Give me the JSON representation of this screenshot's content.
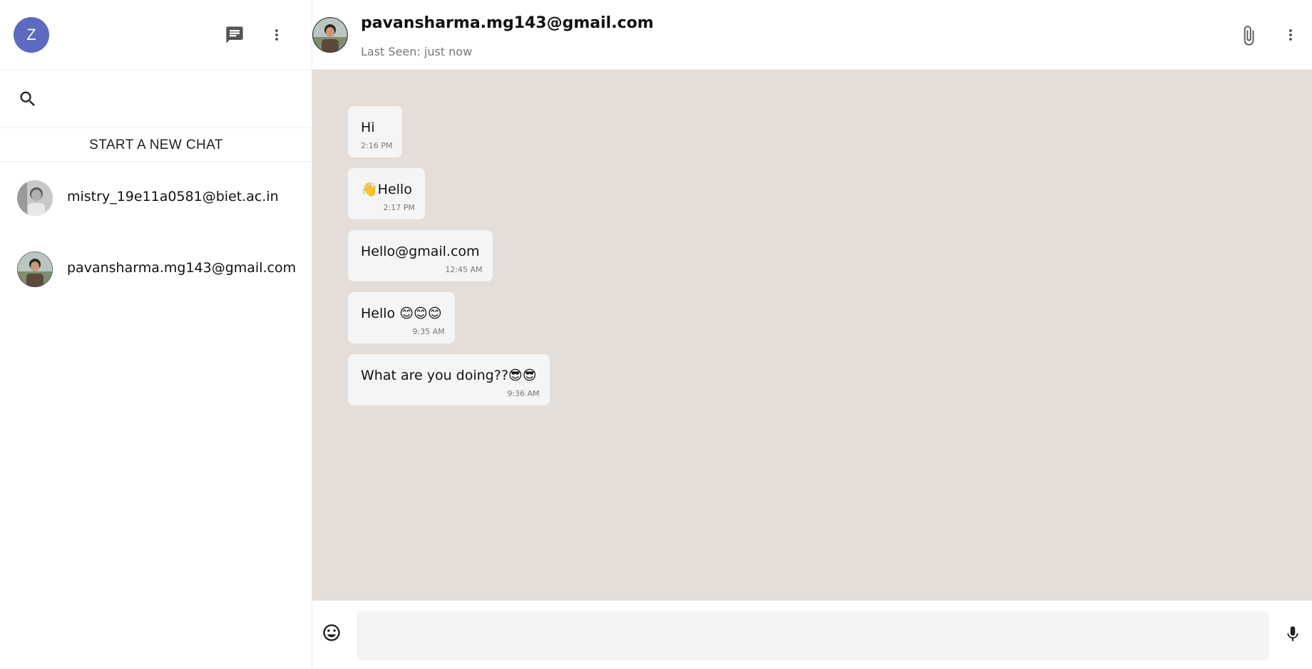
{
  "user": {
    "initial": "Z"
  },
  "sidebar": {
    "search_placeholder": "",
    "new_chat_label": "START A NEW CHAT",
    "chats": [
      {
        "name": "mistry_19e11a0581@biet.ac.in",
        "avatar": "person-photo"
      },
      {
        "name": "pavansharma.mg143@gmail.com",
        "avatar": "person-photo"
      }
    ]
  },
  "chat": {
    "contact_name": "pavansharma.mg143@gmail.com",
    "last_seen": "Last Seen: just now",
    "messages": [
      {
        "text": "Hi",
        "time": "2:16 PM"
      },
      {
        "text": "👋Hello",
        "time": "2:17 PM"
      },
      {
        "text": "Hello@gmail.com",
        "time": "12:45 AM"
      },
      {
        "text": "Hello 😊😊😊",
        "time": "9:35 AM"
      },
      {
        "text": "What are you doing??😎😎",
        "time": "9:36 AM"
      }
    ],
    "input_placeholder": ""
  },
  "colors": {
    "avatar_bg": "#5c6bc0",
    "chat_bg": "#e5ddd8",
    "bubble_bg": "#f5f5f5"
  },
  "icons": [
    "new-chat-icon",
    "more-vert-icon",
    "search-icon",
    "attach-icon",
    "emoji-icon",
    "mic-icon"
  ]
}
